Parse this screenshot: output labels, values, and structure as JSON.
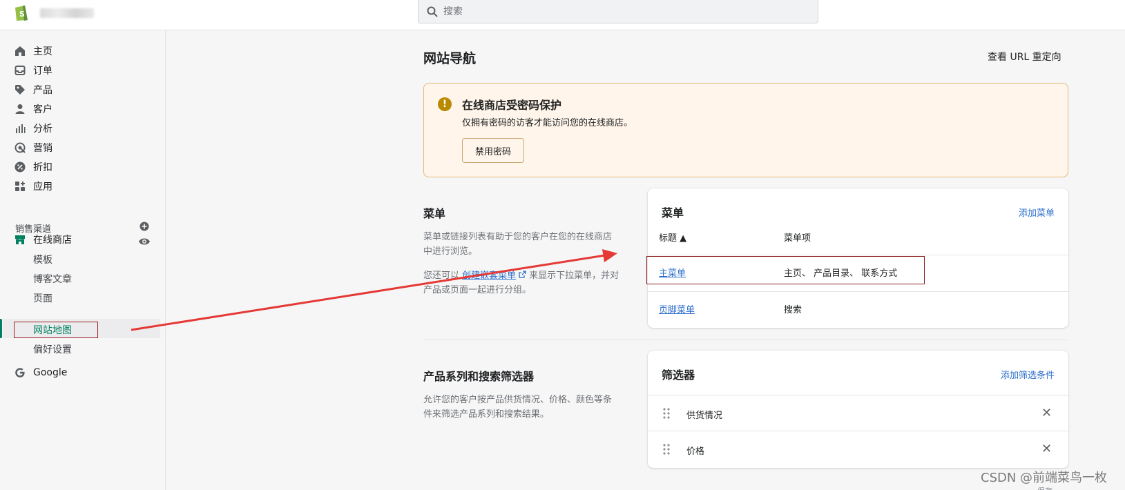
{
  "search": {
    "placeholder": "搜索"
  },
  "sidebar": {
    "items": [
      {
        "label": "主页",
        "icon": "home-icon"
      },
      {
        "label": "订单",
        "icon": "inbox-icon"
      },
      {
        "label": "产品",
        "icon": "tag-icon"
      },
      {
        "label": "客户",
        "icon": "person-icon"
      },
      {
        "label": "分析",
        "icon": "bar-chart-icon"
      },
      {
        "label": "营销",
        "icon": "target-icon"
      },
      {
        "label": "折扣",
        "icon": "discount-icon"
      },
      {
        "label": "应用",
        "icon": "apps-icon"
      }
    ],
    "channels_label": "销售渠道",
    "online_store": "在线商店",
    "sub_items": [
      "模板",
      "博客文章",
      "页面",
      "网站地图",
      "偏好设置"
    ],
    "google": "Google"
  },
  "main": {
    "title": "网站导航",
    "redirect_link": "查看 URL 重定向",
    "banner": {
      "title": "在线商店受密码保护",
      "text": "仅拥有密码的访客才能访问您的在线商店。",
      "button": "禁用密码"
    },
    "menus_section": {
      "title": "菜单",
      "desc": "菜单或链接列表有助于您的客户在您的在线商店中进行浏览。",
      "desc2_pre": "您还可以",
      "desc2_link": "创建嵌套菜单",
      "desc2_post": "来显示下拉菜单，并对产品或页面一起进行分组。"
    },
    "menus_card": {
      "title": "菜单",
      "action": "添加菜单",
      "col_title": "标题 ▲",
      "col_items": "菜单项",
      "rows": [
        {
          "title": "主菜单",
          "items": "主页、 产品目录、 联系方式"
        },
        {
          "title": "页脚菜单",
          "items": "搜索"
        }
      ]
    },
    "filters_section": {
      "title": "产品系列和搜索筛选器",
      "desc": "允许您的客户按产品供货情况、价格、颜色等条件来筛选产品系列和搜索结果。"
    },
    "filters_card": {
      "title": "筛选器",
      "action": "添加筛选条件",
      "rows": [
        "供货情况",
        "价格"
      ]
    }
  },
  "watermark": "CSDN @前端菜鸟一枚",
  "save_peek": "保存",
  "colors": {
    "accent": "#008060",
    "link": "#2c6ecb",
    "banner_bg": "#fff5ea",
    "annotation": "#e53935"
  }
}
